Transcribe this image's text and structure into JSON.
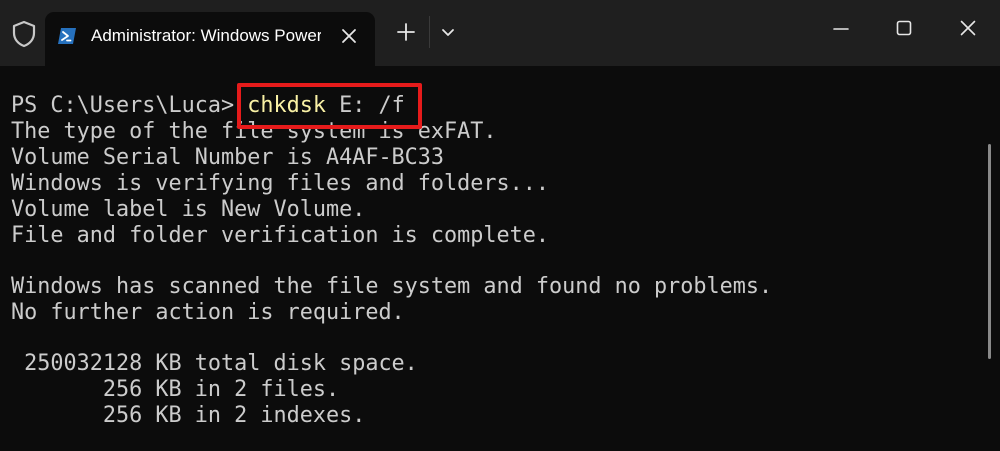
{
  "window": {
    "tab_title": "Administrator: Windows PowerShell",
    "icons": {
      "shield": "shield-icon",
      "tab": "powershell-icon",
      "close_tab": "close-icon",
      "new_tab": "plus-icon",
      "dropdown": "chevron-down-icon",
      "minimize": "minimize-icon",
      "maximize": "maximize-icon",
      "close_window": "close-icon"
    }
  },
  "terminal": {
    "prompt": "PS C:\\Users\\Luca> ",
    "command_name": "chkdsk",
    "command_args": " E: /f",
    "output": [
      "The type of the file system is exFAT.",
      "Volume Serial Number is A4AF-BC33",
      "Windows is verifying files and folders...",
      "Volume label is New Volume.",
      "File and folder verification is complete.",
      "",
      "Windows has scanned the file system and found no problems.",
      "No further action is required.",
      "",
      " 250032128 KB total disk space.",
      "       256 KB in 2 files.",
      "       256 KB in 2 indexes."
    ]
  },
  "colors": {
    "background": "#0c0c0c",
    "titlebar": "#1f1f1f",
    "text": "#cccccc",
    "command": "#f9f1a5",
    "highlight": "#e61b1b",
    "powershell_blue": "#2671be"
  }
}
